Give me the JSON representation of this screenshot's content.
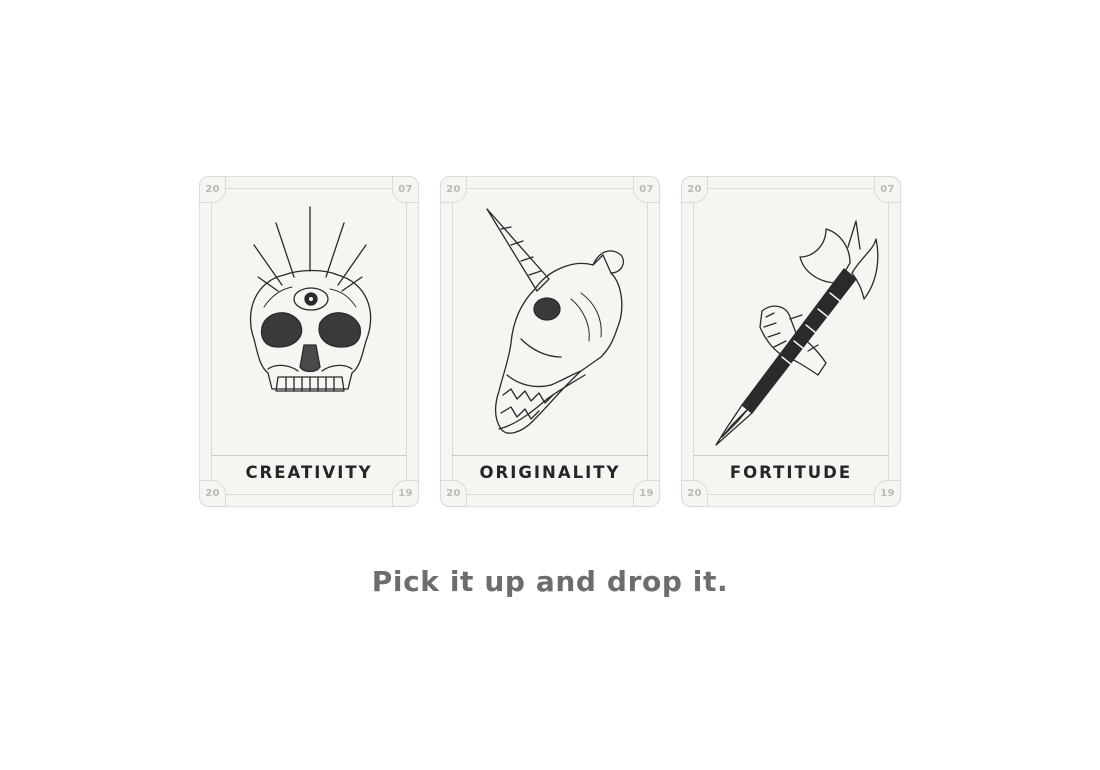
{
  "cards": [
    {
      "title": "CREATIVITY",
      "icon": "third-eye-skull-icon",
      "corners": {
        "top_left": "20",
        "top_right": "07",
        "bottom_left": "20",
        "bottom_right": "19"
      }
    },
    {
      "title": "ORIGINALITY",
      "icon": "unicorn-skull-icon",
      "corners": {
        "top_left": "20",
        "top_right": "07",
        "bottom_left": "20",
        "bottom_right": "19"
      }
    },
    {
      "title": "FORTITUDE",
      "icon": "skeleton-hand-axe-icon",
      "corners": {
        "top_left": "20",
        "top_right": "07",
        "bottom_left": "20",
        "bottom_right": "19"
      }
    }
  ],
  "caption": "Pick it up and drop it.",
  "colors": {
    "card_background": "#f6f5f1",
    "card_border": "#e2e0da",
    "corner_text": "#bdbab3",
    "title_text": "#262626",
    "caption_text": "#6d6d6d",
    "ink": "#2a2a2a"
  }
}
